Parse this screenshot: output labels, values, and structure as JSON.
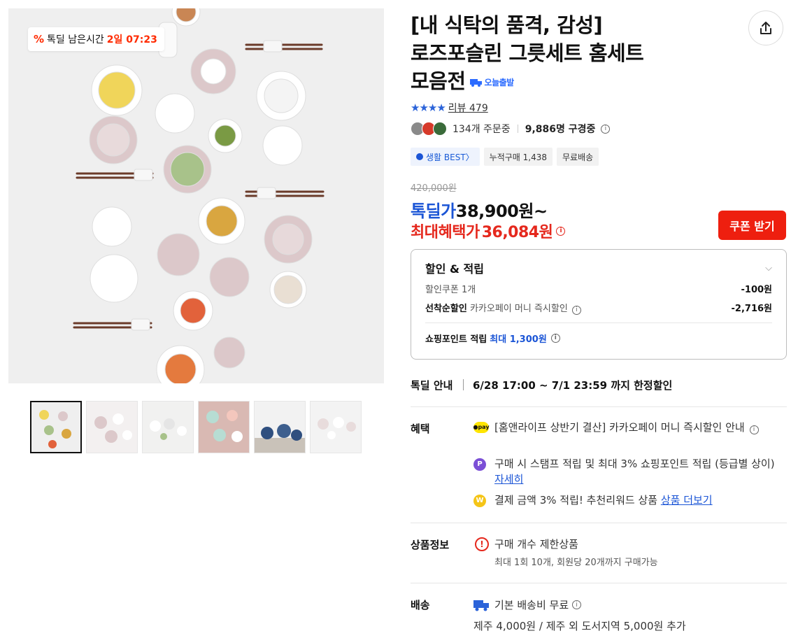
{
  "timer": {
    "icon": "percent-icon",
    "label": "톡딜 남은시간",
    "remain": "2일 07:23"
  },
  "product": {
    "title_line1": "[내 식탁의 품격, 감성]",
    "title_line2": "로즈포슬린 그릇세트 홈세트",
    "title_line3": "모음전",
    "today_badge": "오늘출발",
    "rating_stars": "★★★★",
    "review_label": "리뷰 479",
    "orders": "134개 주문중",
    "viewers": "9,886명 구경중",
    "tags": [
      "생활 BEST〉",
      "누적구매 1,438",
      "무료배송"
    ],
    "original_price": "420,000원",
    "deal_label": "톡딜가",
    "deal_price": "38,900원~",
    "max_label": "최대혜택가",
    "max_price": "36,084원",
    "coupon_button": "쿠폰 받기"
  },
  "benefit_box": {
    "title": "할인 & 적립",
    "coupon_label": "할인쿠폰 1개",
    "coupon_amount": "-100원",
    "first_label": "선착순할인",
    "first_desc": "카카오페이 머니 즉시할인",
    "first_amount": "-2,716원",
    "point_label": "쇼핑포인트 적립",
    "point_value": "최대 1,300원"
  },
  "deal_guide": {
    "key": "톡딜 안내",
    "value": "6/28 17:00 ~ 7/1 23:59 까지 한정할인"
  },
  "benefits": {
    "key": "혜택",
    "items": [
      {
        "icon": "●pay",
        "text": "[홈앤라이프 상반기 결산] 카카오페이 머니 즉시할인 안내",
        "link": ""
      },
      {
        "icon": "P",
        "text": "구매 시 스탬프 적립 및 최대 3% 쇼핑포인트 적립 (등급별 상이)",
        "link": "자세히"
      },
      {
        "icon": "W",
        "text": "결제 금액 3% 적립! 추천리워드 상품",
        "link": "상품 더보기"
      }
    ]
  },
  "product_info": {
    "key": "상품정보",
    "line1": "구매 개수 제한상품",
    "line2": "최대 1회 10개, 회원당 20개까지 구매가능"
  },
  "delivery": {
    "key": "배송",
    "line1": "기본 배송비 무료",
    "line2": "제주 4,000원 / 제주 외 도서지역 5,000원 추가"
  },
  "colors": {
    "accent_blue": "#1b55d6",
    "deal_red": "#e5281d",
    "coupon_red": "#ee1f0f"
  }
}
